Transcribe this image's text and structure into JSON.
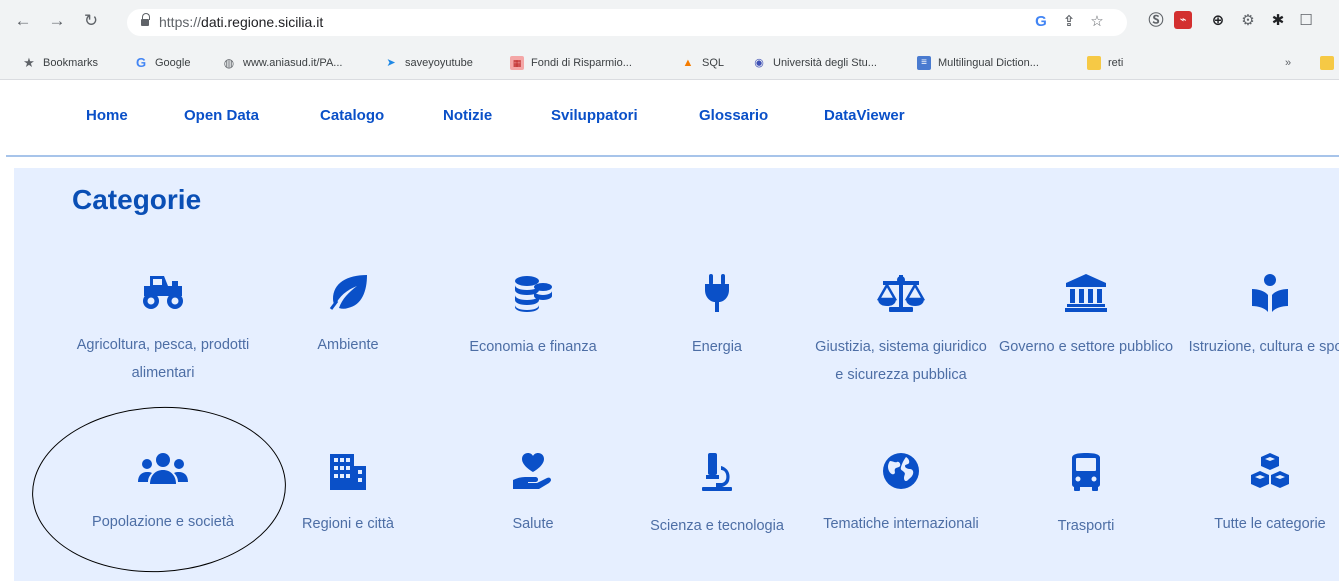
{
  "browser": {
    "url_prefix": "https://",
    "url_host": "dati.regione.sicilia.it",
    "bookmarks": [
      {
        "label": "Bookmarks",
        "icon": "star-icon"
      },
      {
        "label": "Google",
        "icon": "google-icon"
      },
      {
        "label": "www.aniasud.it/PA...",
        "icon": "globe-icon"
      },
      {
        "label": "saveyoyutube",
        "icon": "arrow-icon"
      },
      {
        "label": "Fondi di Risparmio...",
        "icon": "fund-icon"
      },
      {
        "label": "SQL",
        "icon": "sql-icon"
      },
      {
        "label": "Università degli Stu...",
        "icon": "university-icon"
      },
      {
        "label": "Multilingual Diction...",
        "icon": "doc-icon"
      },
      {
        "label": "reti",
        "icon": "folder-icon"
      }
    ]
  },
  "nav": {
    "items": [
      "Home",
      "Open Data",
      "Catalogo",
      "Notizie",
      "Sviluppatori",
      "Glossario",
      "DataViewer"
    ]
  },
  "section": {
    "title": "Categorie"
  },
  "categories": [
    {
      "label": "Agricoltura, pesca, prodotti alimentari",
      "icon": "tractor-icon"
    },
    {
      "label": "Ambiente",
      "icon": "leaf-icon"
    },
    {
      "label": "Economia e finanza",
      "icon": "coins-icon"
    },
    {
      "label": "Energia",
      "icon": "plug-icon"
    },
    {
      "label": "Giustizia, sistema giuridico e sicurezza pubblica",
      "icon": "scale-icon"
    },
    {
      "label": "Governo e settore pubblico",
      "icon": "landmark-icon"
    },
    {
      "label": "Istruzione, cultura e sport",
      "icon": "reader-icon"
    },
    {
      "label": "Popolazione e società",
      "icon": "users-icon"
    },
    {
      "label": "Regioni e città",
      "icon": "city-icon"
    },
    {
      "label": "Salute",
      "icon": "hand-heart-icon"
    },
    {
      "label": "Scienza e tecnologia",
      "icon": "microscope-icon"
    },
    {
      "label": "Tematiche internazionali",
      "icon": "globe-icon"
    },
    {
      "label": "Trasporti",
      "icon": "bus-icon"
    },
    {
      "label": "Tutte le categorie",
      "icon": "cubes-icon"
    }
  ],
  "colors": {
    "brand_blue": "#0a50c8",
    "label_blue": "#4d6ea5",
    "panel_bg": "#e6efff"
  }
}
